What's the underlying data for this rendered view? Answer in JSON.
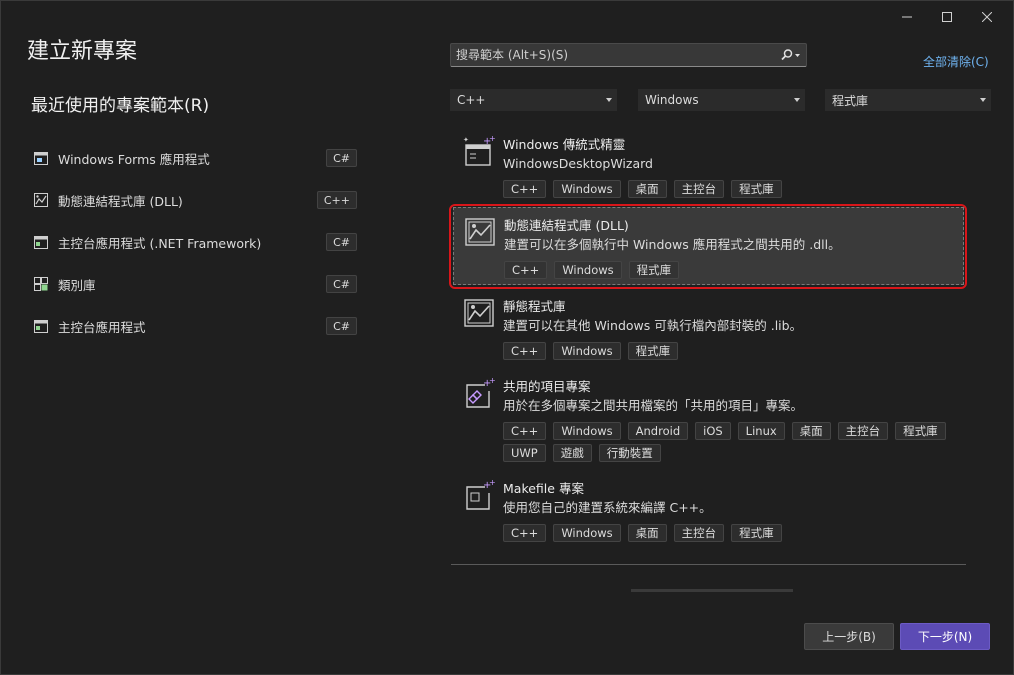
{
  "window": {
    "controls": [
      "minimize",
      "maximize",
      "close"
    ]
  },
  "page_title": "建立新專案",
  "recent": {
    "title": "最近使用的專案範本(R)",
    "items": [
      {
        "label": "Windows Forms 應用程式",
        "lang": "C#",
        "icon": "form-window-icon"
      },
      {
        "label": "動態連結程式庫 (DLL)",
        "lang": "C++",
        "icon": "dll-library-icon"
      },
      {
        "label": "主控台應用程式 (.NET Framework)",
        "lang": "C#",
        "icon": "console-app-icon"
      },
      {
        "label": "類別庫",
        "lang": "C#",
        "icon": "class-library-icon"
      },
      {
        "label": "主控台應用程式",
        "lang": "C#",
        "icon": "console-app-icon"
      }
    ]
  },
  "search": {
    "value": "",
    "placeholder": "搜尋範本 (Alt+S)(S)"
  },
  "clear_all": "全部清除(C)",
  "filters": {
    "language": "C++",
    "platform": "Windows",
    "project_type": "程式庫"
  },
  "templates": [
    {
      "name": "Windows 傳統式精靈",
      "desc": "WindowsDesktopWizard",
      "tags": [
        "C++",
        "Windows",
        "桌面",
        "主控台",
        "程式庫"
      ]
    },
    {
      "name": "動態連結程式庫 (DLL)",
      "desc": "建置可以在多個執行中 Windows 應用程式之間共用的 .dll。",
      "tags": [
        "C++",
        "Windows",
        "程式庫"
      ],
      "selected": true
    },
    {
      "name": "靜態程式庫",
      "desc": "建置可以在其他 Windows 可執行檔內部封裝的 .lib。",
      "tags": [
        "C++",
        "Windows",
        "程式庫"
      ]
    },
    {
      "name": "共用的項目專案",
      "desc": "用於在多個專案之間共用檔案的「共用的項目」專案。",
      "tags": [
        "C++",
        "Windows",
        "Android",
        "iOS",
        "Linux",
        "桌面",
        "主控台",
        "程式庫",
        "UWP",
        "遊戲",
        "行動裝置"
      ]
    },
    {
      "name": "Makefile 專案",
      "desc": "使用您自己的建置系統來編譯 C++。",
      "tags": [
        "C++",
        "Windows",
        "桌面",
        "主控台",
        "程式庫"
      ]
    }
  ],
  "buttons": {
    "back": "上一步(B)",
    "next": "下一步(N)"
  },
  "colors": {
    "background": "#1f1f1f",
    "accent": "#5c4bb5",
    "link": "#6fb3f0",
    "selection_outline": "#d9161a"
  }
}
